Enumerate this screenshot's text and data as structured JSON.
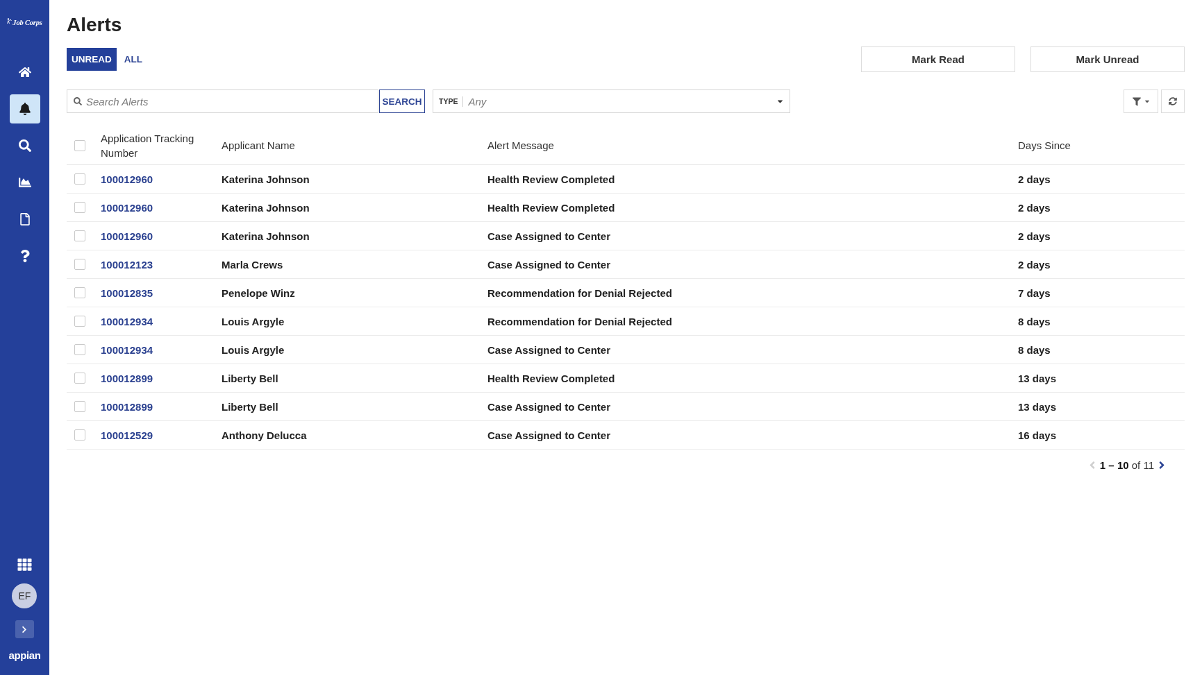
{
  "sidebar": {
    "logo": "Job Corps",
    "nav_items": [
      {
        "kind": "home",
        "selected": false
      },
      {
        "kind": "bell",
        "selected": true
      },
      {
        "kind": "search",
        "selected": false
      },
      {
        "kind": "chart",
        "selected": false
      },
      {
        "kind": "document",
        "selected": false
      },
      {
        "kind": "help",
        "selected": false
      }
    ],
    "avatar": {
      "initials": "EF"
    },
    "brand": "appian"
  },
  "page": {
    "title": "Alerts"
  },
  "tabs": [
    {
      "label": "UNREAD",
      "selected": true
    },
    {
      "label": "ALL",
      "selected": false
    }
  ],
  "actions": [
    "Mark Read",
    "Mark Unread"
  ],
  "search": {
    "placeholder": "Search Alerts",
    "button": "SEARCH"
  },
  "type_filter": {
    "label": "TYPE",
    "placeholder": "Any"
  },
  "table": {
    "select_all": {
      "checked": false
    },
    "columns": [
      "Application Tracking Number",
      "Applicant Name",
      "Alert Message",
      "Days Since"
    ],
    "rows": [
      {
        "checked": false,
        "tracking_number": "100012960",
        "applicant_name": "Katerina Johnson",
        "alert_message": "Health Review Completed",
        "days_since": "2 days"
      },
      {
        "checked": false,
        "tracking_number": "100012960",
        "applicant_name": "Katerina Johnson",
        "alert_message": "Health Review Completed",
        "days_since": "2 days"
      },
      {
        "checked": false,
        "tracking_number": "100012960",
        "applicant_name": "Katerina Johnson",
        "alert_message": "Case Assigned to Center",
        "days_since": "2 days"
      },
      {
        "checked": false,
        "tracking_number": "100012123",
        "applicant_name": "Marla Crews",
        "alert_message": "Case Assigned to Center",
        "days_since": "2 days"
      },
      {
        "checked": false,
        "tracking_number": "100012835",
        "applicant_name": "Penelope Winz",
        "alert_message": "Recommendation for Denial Rejected",
        "days_since": "7 days"
      },
      {
        "checked": false,
        "tracking_number": "100012934",
        "applicant_name": "Louis Argyle",
        "alert_message": "Recommendation for Denial Rejected",
        "days_since": "8 days"
      },
      {
        "checked": false,
        "tracking_number": "100012934",
        "applicant_name": "Louis Argyle",
        "alert_message": "Case Assigned to Center",
        "days_since": "8 days"
      },
      {
        "checked": false,
        "tracking_number": "100012899",
        "applicant_name": "Liberty Bell",
        "alert_message": "Health Review Completed",
        "days_since": "13 days"
      },
      {
        "checked": false,
        "tracking_number": "100012899",
        "applicant_name": "Liberty Bell",
        "alert_message": "Case Assigned to Center",
        "days_since": "13 days"
      },
      {
        "checked": false,
        "tracking_number": "100012529",
        "applicant_name": "Anthony Delucca",
        "alert_message": "Case Assigned to Center",
        "days_since": "16 days"
      }
    ]
  },
  "pagination": {
    "summary": "**1 – 10** of 11",
    "prev_disabled": true,
    "next_disabled": false
  }
}
